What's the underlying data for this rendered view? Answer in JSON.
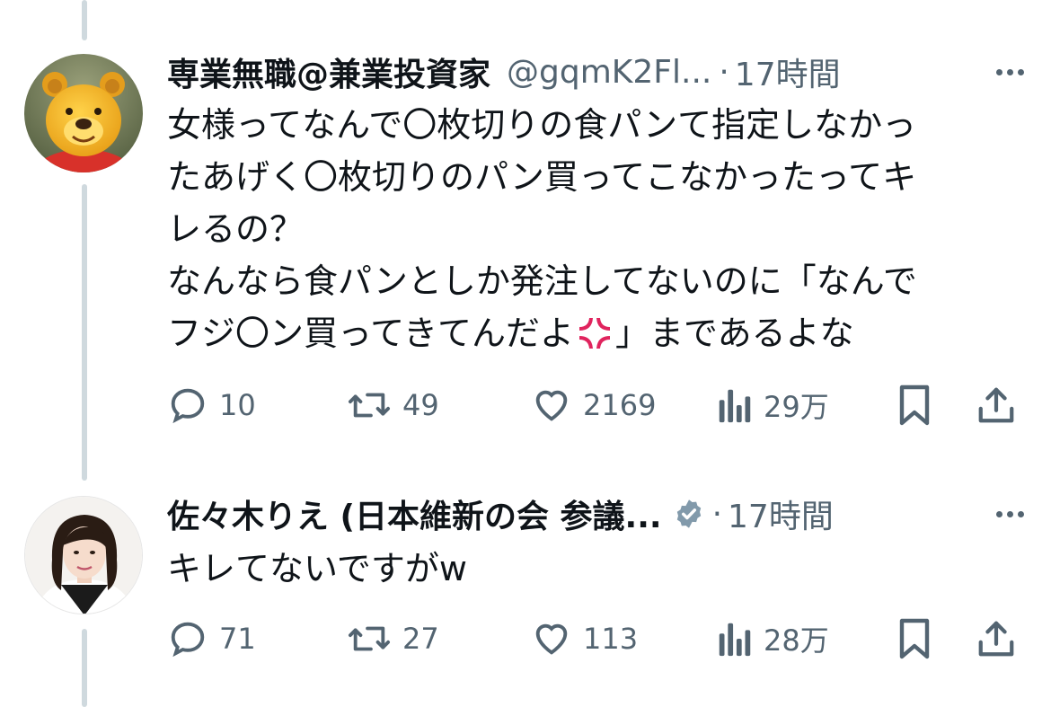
{
  "tweets": [
    {
      "name": "専業無職@兼業投資家",
      "handle": "@gqmK2Fl...",
      "separator": "·",
      "time": "17時間",
      "lines": [
        "女様ってなんで〇枚切りの食パンて指定しなかっ",
        "たあげく〇枚切りのパン買ってこなかったってキ",
        "レるの？",
        "なんなら食パンとしか発注してないのに「なんで",
        "フジ〇ン買ってきてんだよ",
        "」まであるよな"
      ],
      "emoji_icon": "anger-symbol-icon",
      "actions": {
        "replies": "10",
        "retweets": "49",
        "likes": "2169",
        "views": "29万"
      }
    },
    {
      "name": "佐々木りえ (日本維新の会 参議...",
      "verified_icon": "verified-badge-icon",
      "separator": "·",
      "time": "17時間",
      "lines": [
        "キレてないですがw"
      ],
      "actions": {
        "replies": "71",
        "retweets": "27",
        "likes": "113",
        "views": "28万"
      }
    }
  ],
  "colors": {
    "text": "#0f1419",
    "secondary": "#536471",
    "thread_line": "#cfd9de",
    "anger": "#e0245e"
  }
}
